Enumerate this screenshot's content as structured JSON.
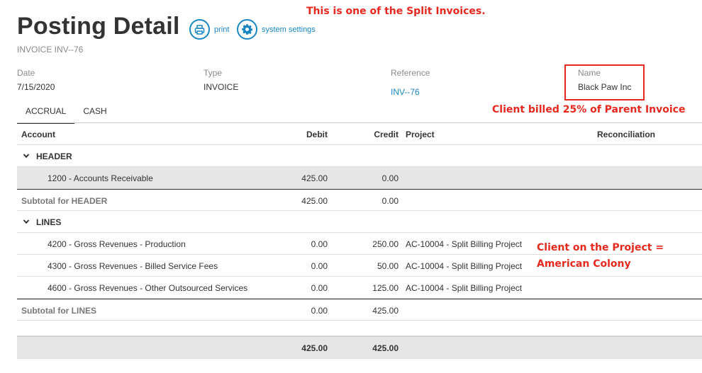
{
  "page": {
    "title": "Posting Detail",
    "subtitle": "INVOICE INV--76"
  },
  "actions": {
    "print_label": "print",
    "settings_label": "system settings"
  },
  "notes": {
    "split": "This is one of the Split Invoices.",
    "client_billed": "Client billed 25% of  Parent Invoice",
    "client_project_line1": "Client on the Project =",
    "client_project_line2": "American Colony"
  },
  "meta": {
    "date_label": "Date",
    "date_value": "7/15/2020",
    "type_label": "Type",
    "type_value": "INVOICE",
    "reference_label": "Reference",
    "reference_value": "INV--76",
    "name_label": "Name",
    "name_value": "Black Paw Inc"
  },
  "tabs": [
    "ACCRUAL",
    "CASH"
  ],
  "table": {
    "headers": {
      "account": "Account",
      "debit": "Debit",
      "credit": "Credit",
      "project": "Project",
      "reconciliation": "Reconciliation"
    },
    "groups": [
      {
        "name": "HEADER",
        "rows": [
          {
            "account": "1200 - Accounts Receivable",
            "debit": "425.00",
            "credit": "0.00",
            "project": ""
          }
        ],
        "subtotal": {
          "label": "Subtotal for HEADER",
          "debit": "425.00",
          "credit": "0.00"
        }
      },
      {
        "name": "LINES",
        "rows": [
          {
            "account": "4200 - Gross Revenues - Production",
            "debit": "0.00",
            "credit": "250.00",
            "project": "AC-10004 - Split Billing Project"
          },
          {
            "account": "4300 - Gross Revenues - Billed Service Fees",
            "debit": "0.00",
            "credit": "50.00",
            "project": "AC-10004 - Split Billing Project"
          },
          {
            "account": "4600 - Gross Revenues - Other Outsourced Services",
            "debit": "0.00",
            "credit": "125.00",
            "project": "AC-10004 - Split Billing Project"
          }
        ],
        "subtotal": {
          "label": "Subtotal for LINES",
          "debit": "0.00",
          "credit": "425.00"
        }
      }
    ],
    "total": {
      "debit": "425.00",
      "credit": "425.00"
    }
  },
  "colors": {
    "accent": "#1a87c4",
    "annotation": "#e8281e",
    "selected_row": "#e6e6e6"
  }
}
